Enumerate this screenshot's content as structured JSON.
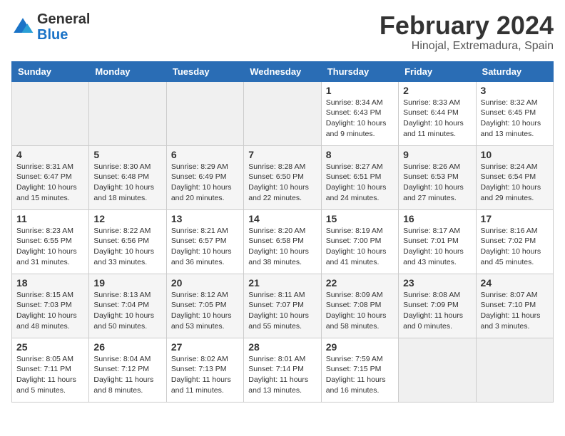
{
  "header": {
    "logo_general": "General",
    "logo_blue": "Blue",
    "title": "February 2024",
    "subtitle": "Hinojal, Extremadura, Spain"
  },
  "days_of_week": [
    "Sunday",
    "Monday",
    "Tuesday",
    "Wednesday",
    "Thursday",
    "Friday",
    "Saturday"
  ],
  "weeks": [
    [
      {
        "day": "",
        "info": ""
      },
      {
        "day": "",
        "info": ""
      },
      {
        "day": "",
        "info": ""
      },
      {
        "day": "",
        "info": ""
      },
      {
        "day": "1",
        "info": "Sunrise: 8:34 AM\nSunset: 6:43 PM\nDaylight: 10 hours\nand 9 minutes."
      },
      {
        "day": "2",
        "info": "Sunrise: 8:33 AM\nSunset: 6:44 PM\nDaylight: 10 hours\nand 11 minutes."
      },
      {
        "day": "3",
        "info": "Sunrise: 8:32 AM\nSunset: 6:45 PM\nDaylight: 10 hours\nand 13 minutes."
      }
    ],
    [
      {
        "day": "4",
        "info": "Sunrise: 8:31 AM\nSunset: 6:47 PM\nDaylight: 10 hours\nand 15 minutes."
      },
      {
        "day": "5",
        "info": "Sunrise: 8:30 AM\nSunset: 6:48 PM\nDaylight: 10 hours\nand 18 minutes."
      },
      {
        "day": "6",
        "info": "Sunrise: 8:29 AM\nSunset: 6:49 PM\nDaylight: 10 hours\nand 20 minutes."
      },
      {
        "day": "7",
        "info": "Sunrise: 8:28 AM\nSunset: 6:50 PM\nDaylight: 10 hours\nand 22 minutes."
      },
      {
        "day": "8",
        "info": "Sunrise: 8:27 AM\nSunset: 6:51 PM\nDaylight: 10 hours\nand 24 minutes."
      },
      {
        "day": "9",
        "info": "Sunrise: 8:26 AM\nSunset: 6:53 PM\nDaylight: 10 hours\nand 27 minutes."
      },
      {
        "day": "10",
        "info": "Sunrise: 8:24 AM\nSunset: 6:54 PM\nDaylight: 10 hours\nand 29 minutes."
      }
    ],
    [
      {
        "day": "11",
        "info": "Sunrise: 8:23 AM\nSunset: 6:55 PM\nDaylight: 10 hours\nand 31 minutes."
      },
      {
        "day": "12",
        "info": "Sunrise: 8:22 AM\nSunset: 6:56 PM\nDaylight: 10 hours\nand 33 minutes."
      },
      {
        "day": "13",
        "info": "Sunrise: 8:21 AM\nSunset: 6:57 PM\nDaylight: 10 hours\nand 36 minutes."
      },
      {
        "day": "14",
        "info": "Sunrise: 8:20 AM\nSunset: 6:58 PM\nDaylight: 10 hours\nand 38 minutes."
      },
      {
        "day": "15",
        "info": "Sunrise: 8:19 AM\nSunset: 7:00 PM\nDaylight: 10 hours\nand 41 minutes."
      },
      {
        "day": "16",
        "info": "Sunrise: 8:17 AM\nSunset: 7:01 PM\nDaylight: 10 hours\nand 43 minutes."
      },
      {
        "day": "17",
        "info": "Sunrise: 8:16 AM\nSunset: 7:02 PM\nDaylight: 10 hours\nand 45 minutes."
      }
    ],
    [
      {
        "day": "18",
        "info": "Sunrise: 8:15 AM\nSunset: 7:03 PM\nDaylight: 10 hours\nand 48 minutes."
      },
      {
        "day": "19",
        "info": "Sunrise: 8:13 AM\nSunset: 7:04 PM\nDaylight: 10 hours\nand 50 minutes."
      },
      {
        "day": "20",
        "info": "Sunrise: 8:12 AM\nSunset: 7:05 PM\nDaylight: 10 hours\nand 53 minutes."
      },
      {
        "day": "21",
        "info": "Sunrise: 8:11 AM\nSunset: 7:07 PM\nDaylight: 10 hours\nand 55 minutes."
      },
      {
        "day": "22",
        "info": "Sunrise: 8:09 AM\nSunset: 7:08 PM\nDaylight: 10 hours\nand 58 minutes."
      },
      {
        "day": "23",
        "info": "Sunrise: 8:08 AM\nSunset: 7:09 PM\nDaylight: 11 hours\nand 0 minutes."
      },
      {
        "day": "24",
        "info": "Sunrise: 8:07 AM\nSunset: 7:10 PM\nDaylight: 11 hours\nand 3 minutes."
      }
    ],
    [
      {
        "day": "25",
        "info": "Sunrise: 8:05 AM\nSunset: 7:11 PM\nDaylight: 11 hours\nand 5 minutes."
      },
      {
        "day": "26",
        "info": "Sunrise: 8:04 AM\nSunset: 7:12 PM\nDaylight: 11 hours\nand 8 minutes."
      },
      {
        "day": "27",
        "info": "Sunrise: 8:02 AM\nSunset: 7:13 PM\nDaylight: 11 hours\nand 11 minutes."
      },
      {
        "day": "28",
        "info": "Sunrise: 8:01 AM\nSunset: 7:14 PM\nDaylight: 11 hours\nand 13 minutes."
      },
      {
        "day": "29",
        "info": "Sunrise: 7:59 AM\nSunset: 7:15 PM\nDaylight: 11 hours\nand 16 minutes."
      },
      {
        "day": "",
        "info": ""
      },
      {
        "day": "",
        "info": ""
      }
    ]
  ]
}
